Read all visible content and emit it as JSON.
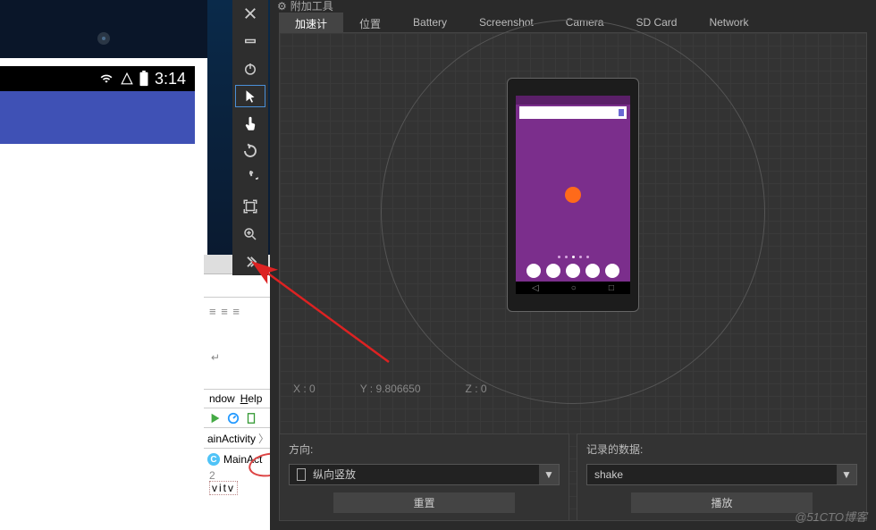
{
  "phone": {
    "time": "3:14"
  },
  "ide": {
    "menu_window": "ndow",
    "menu_help": "Help",
    "breadcrumb": "ainActivity",
    "filename": "MainAct",
    "line_num": "2",
    "code_frag": "vitv"
  },
  "ext": {
    "title": "附加工具",
    "tabs": [
      "加速计",
      "位置",
      "Battery",
      "Screenshot",
      "Camera",
      "SD Card",
      "Network"
    ],
    "active_tab": 0,
    "coords": {
      "x": "X : 0",
      "y": "Y : 9.806650",
      "z": "Z : 0"
    },
    "direction": {
      "label": "方向:",
      "value": "纵向竖放",
      "reset": "重置"
    },
    "recorded": {
      "label": "记录的数据:",
      "value": "shake",
      "play": "播放"
    }
  },
  "watermark": "@51CTO博客"
}
